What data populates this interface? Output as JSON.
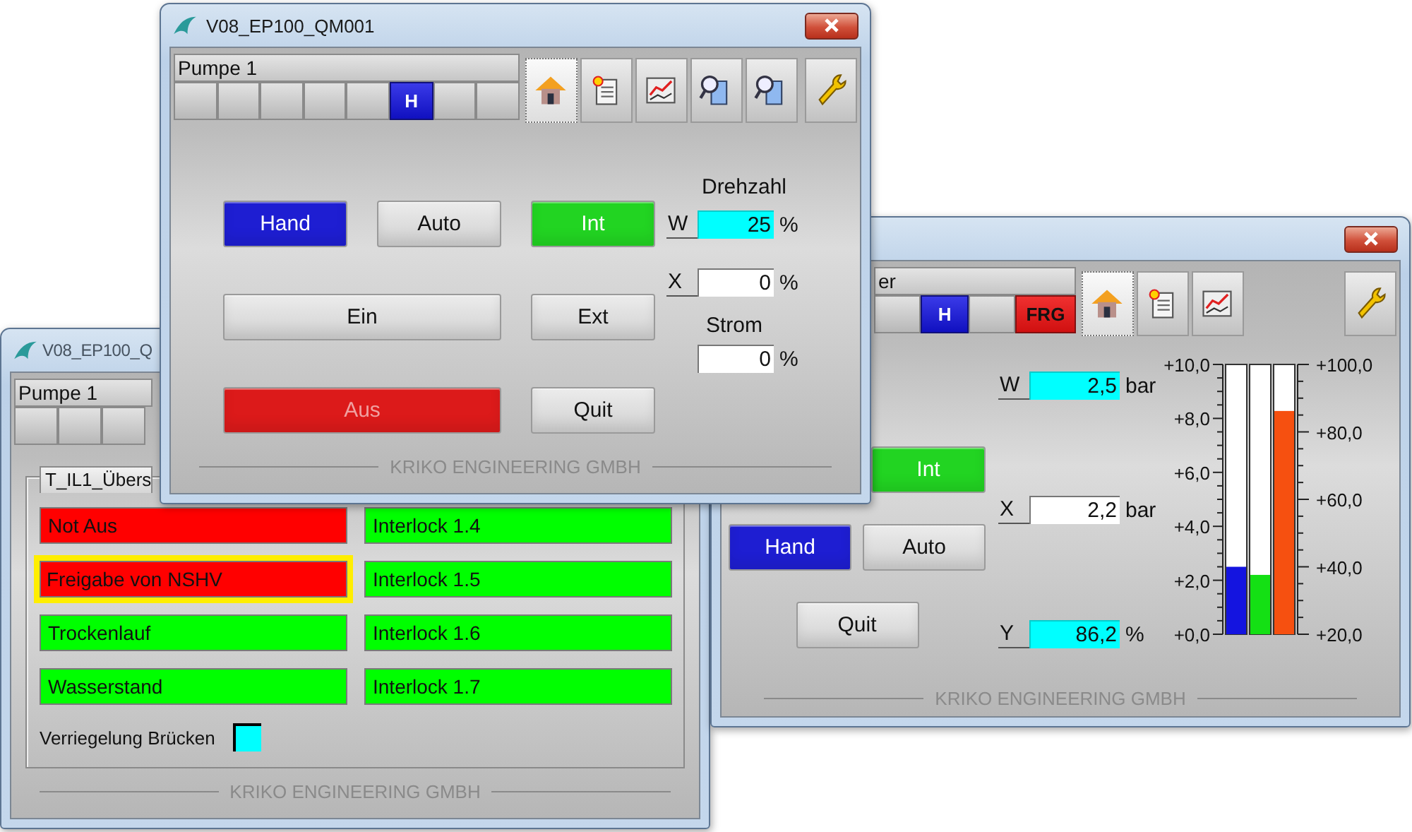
{
  "front_window": {
    "title": "V08_EP100_QM001",
    "header_field": "Pumpe 1",
    "status_cells": [
      {
        "kind": "empty"
      },
      {
        "kind": "empty"
      },
      {
        "kind": "empty"
      },
      {
        "kind": "empty"
      },
      {
        "kind": "empty"
      },
      {
        "kind": "hand",
        "label": "H"
      },
      {
        "kind": "empty"
      },
      {
        "kind": "empty"
      }
    ],
    "toolbar": [
      {
        "kind": "home",
        "selected": true
      },
      {
        "kind": "log",
        "selected": false
      },
      {
        "kind": "trend",
        "selected": false
      },
      {
        "kind": "zoom",
        "selected": false
      },
      {
        "kind": "zoom",
        "selected": false
      },
      {
        "kind": "wrench",
        "selected": false
      }
    ],
    "buttons": [
      {
        "kind": "hand",
        "label": "Hand",
        "color": "#1e1ed2",
        "disabled": false
      },
      {
        "kind": "auto",
        "label": "Auto",
        "disabled": false
      },
      {
        "kind": "int",
        "label": "Int",
        "color": "#22d422",
        "disabled": false
      },
      {
        "kind": "ein",
        "label": "Ein",
        "disabled": false
      },
      {
        "kind": "ext",
        "label": "Ext",
        "disabled": false
      },
      {
        "kind": "aus",
        "label": "Aus",
        "color": "#dc1a1a",
        "disabled": true
      },
      {
        "kind": "quit",
        "label": "Quit",
        "disabled": false
      }
    ],
    "speed": {
      "title": "Drehzahl",
      "readings": [
        {
          "label": "W",
          "value": "25",
          "unit": "%",
          "editable": true
        },
        {
          "label": "X",
          "value": "0",
          "unit": "%",
          "editable": false
        }
      ]
    },
    "current": {
      "title": "Strom",
      "readings": [
        {
          "value": "0",
          "unit": "%",
          "editable": false
        }
      ]
    },
    "footer": "KRIKO ENGINEERING GMBH"
  },
  "right_window": {
    "header_field": "er",
    "status_cells": [
      {
        "kind": "empty"
      },
      {
        "kind": "hand",
        "label": "H"
      },
      {
        "kind": "empty"
      },
      {
        "kind": "release",
        "label": "FRG"
      }
    ],
    "toolbar": [
      {
        "kind": "home",
        "selected": true
      },
      {
        "kind": "log",
        "selected": false
      },
      {
        "kind": "trend",
        "selected": false
      },
      {
        "kind": "wrench",
        "selected": false
      }
    ],
    "buttons": [
      {
        "kind": "int",
        "label": "Int",
        "color": "#22d422",
        "disabled": false
      },
      {
        "kind": "hand",
        "label": "Hand",
        "color": "#1e1ed2",
        "disabled": false
      },
      {
        "kind": "auto",
        "label": "Auto",
        "disabled": false
      },
      {
        "kind": "quit",
        "label": "Quit",
        "disabled": false
      }
    ],
    "readings": [
      {
        "label": "W",
        "value": "2,5",
        "unit": "bar",
        "editable": true
      },
      {
        "label": "X",
        "value": "2,2",
        "unit": "bar",
        "editable": false
      },
      {
        "label": "Y",
        "value": "86,2",
        "unit": "%",
        "editable": true
      }
    ],
    "meters": [
      {
        "level": 0.25,
        "color": "#1414e0"
      },
      {
        "level": 0.22,
        "color": "#14e014"
      },
      {
        "level": 0.8275,
        "color": "#f65010"
      }
    ],
    "left_scale": [
      "+10,0",
      "+8,0",
      "+6,0",
      "+4,0",
      "+2,0",
      "+0,0"
    ],
    "right_scale": [
      "+100,0",
      "+80,0",
      "+60,0",
      "+40,0",
      "+20,0"
    ],
    "footer": "KRIKO ENGINEERING GMBH"
  },
  "left_window": {
    "title": "V08_EP100_Q",
    "header_field": "Pumpe 1",
    "status_cells": [
      {
        "kind": "empty"
      },
      {
        "kind": "empty"
      },
      {
        "kind": "empty"
      }
    ],
    "group": {
      "tab": "T_IL1_Übers",
      "interlocks": [
        {
          "label": "Not Aus",
          "color": "#ff0000",
          "selected": false
        },
        {
          "label": "Interlock 1.4",
          "color": "#00ff00",
          "selected": false
        },
        {
          "label": "Freigabe von NSHV",
          "color": "#ff0000",
          "selected": true
        },
        {
          "label": "Interlock 1.5",
          "color": "#00ff00",
          "selected": false
        },
        {
          "label": "Trockenlauf",
          "color": "#00ff00",
          "selected": false
        },
        {
          "label": "Interlock 1.6",
          "color": "#00ff00",
          "selected": false
        },
        {
          "label": "Wasserstand",
          "color": "#00ff00",
          "selected": false
        },
        {
          "label": "Interlock 1.7",
          "color": "#00ff00",
          "selected": false
        }
      ],
      "bypass": {
        "label": "Verriegelung Brücken",
        "checked": false
      }
    },
    "footer": "KRIKO ENGINEERING GMBH"
  }
}
